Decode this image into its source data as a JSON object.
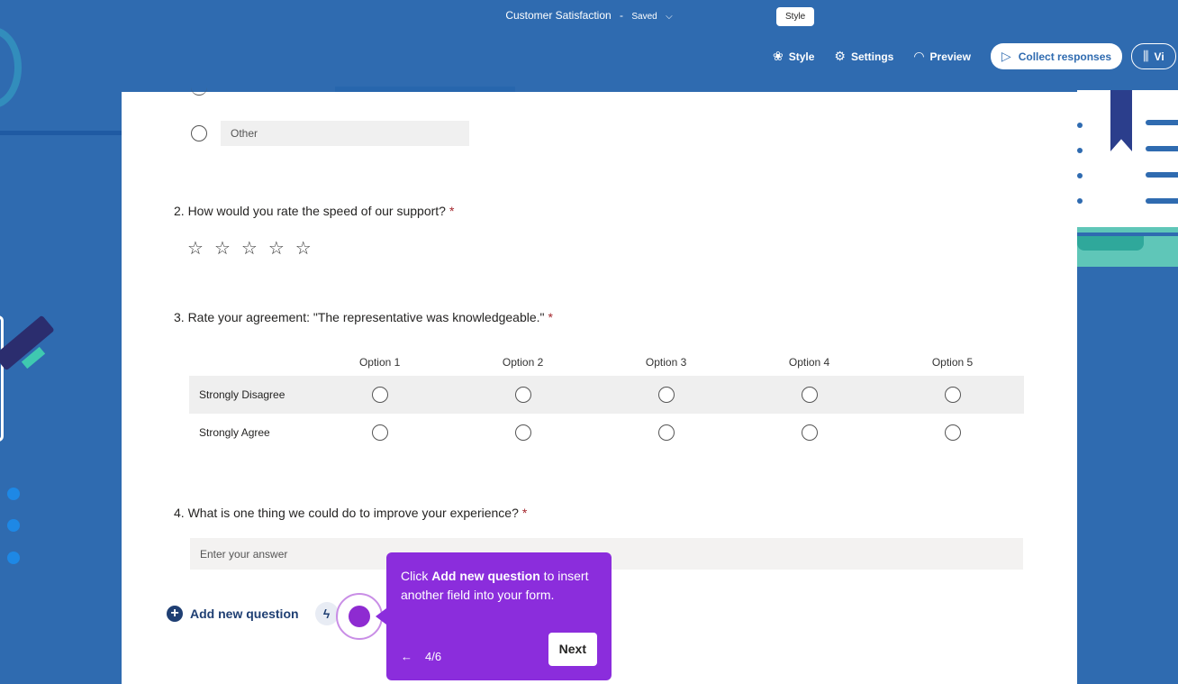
{
  "header": {
    "form_title": "Customer Satisfaction",
    "separator": "-",
    "status": "Saved",
    "tooltip": "Style"
  },
  "toolbar": {
    "style_label": "Style",
    "settings_label": "Settings",
    "preview_label": "Preview",
    "collect_label": "Collect responses",
    "view_label": "Vi"
  },
  "form": {
    "other_option": "Other",
    "q2": {
      "title": "2. How would you rate the speed of our support?",
      "required": "*",
      "rating_max": 5,
      "rating_value": 0
    },
    "q3": {
      "title": "3. Rate your agreement: \"The representative was knowledgeable.\"",
      "required": "*",
      "columns": [
        "Option 1",
        "Option 2",
        "Option 3",
        "Option 4",
        "Option 5"
      ],
      "rows": [
        "Strongly Disagree",
        "Strongly Agree"
      ]
    },
    "q4": {
      "title": "4. What is one thing we could do to improve your experience?",
      "required": "*",
      "placeholder": "Enter your answer"
    },
    "add_question_label": "Add new question"
  },
  "guide": {
    "text_before": "Click ",
    "text_bold": "Add new question",
    "text_after": " to insert another field into your form.",
    "step": "4/6",
    "back_symbol": "←",
    "next_label": "Next"
  }
}
